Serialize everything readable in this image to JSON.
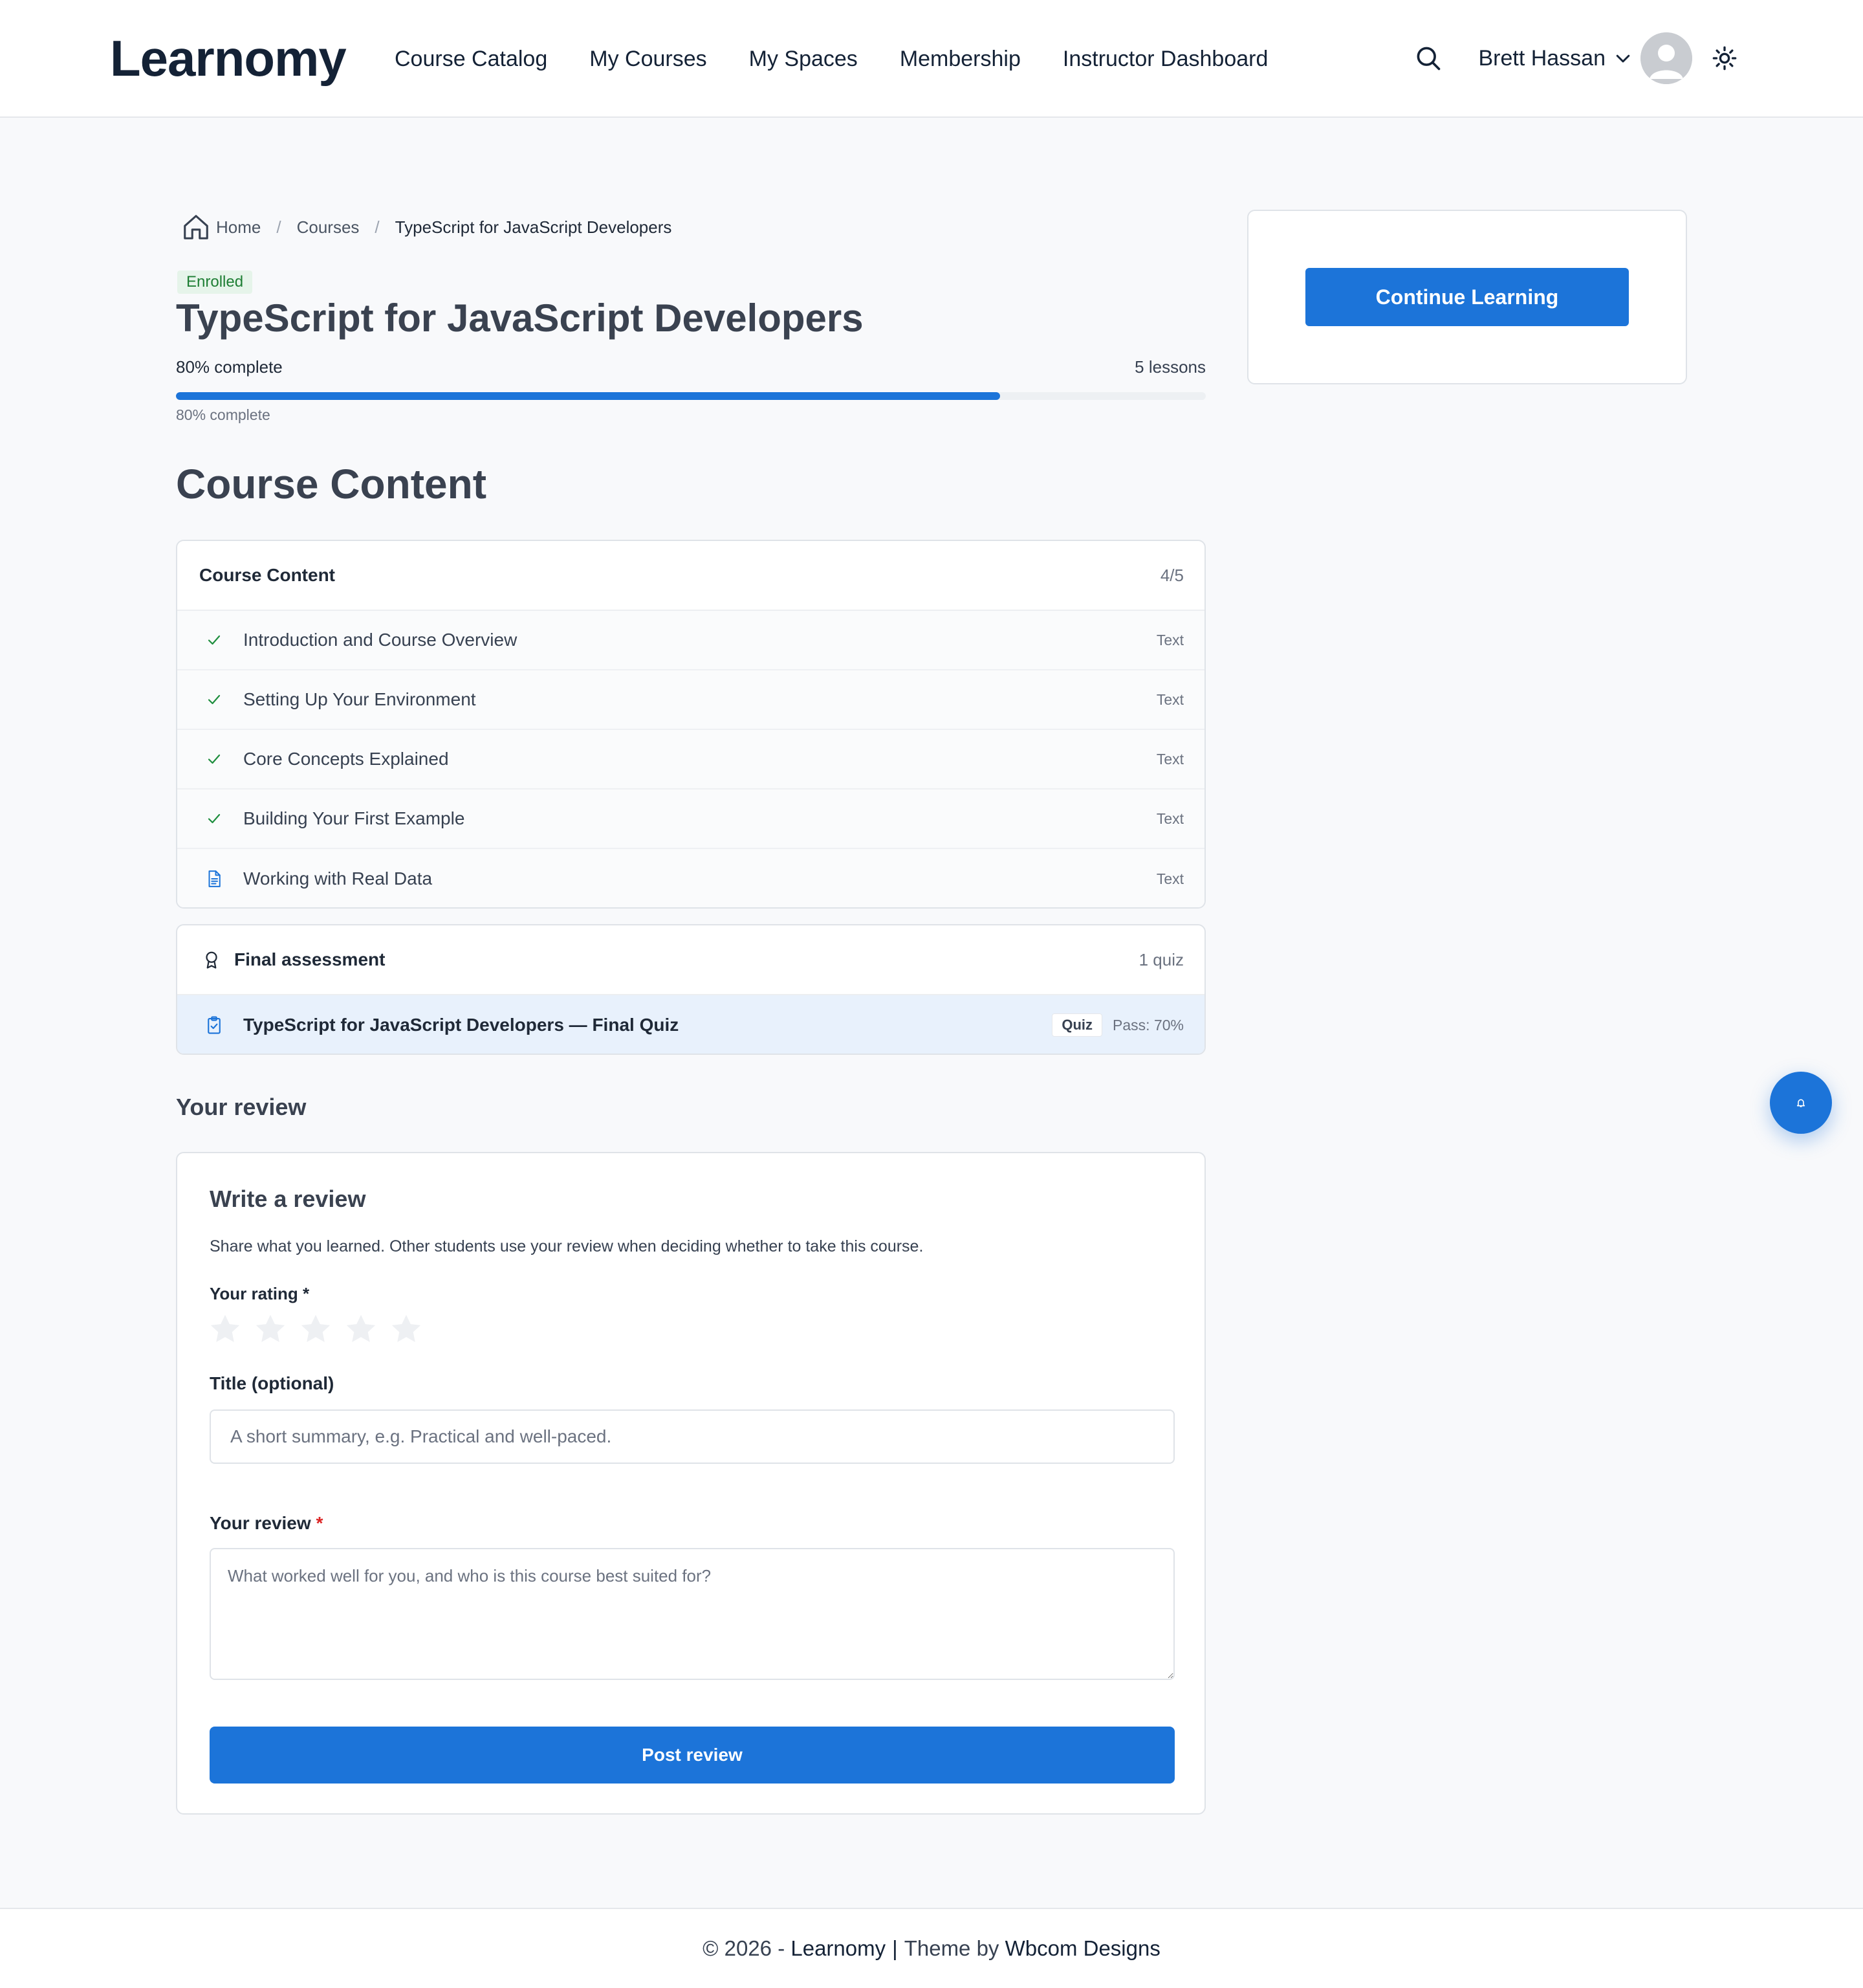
{
  "header": {
    "logo": "Learnomy",
    "nav": [
      "Course Catalog",
      "My Courses",
      "My Spaces",
      "Membership",
      "Instructor Dashboard"
    ],
    "user_name": "Brett Hassan",
    "icons": [
      "search-icon",
      "chevron-down-icon",
      "avatar",
      "sun-icon"
    ]
  },
  "breadcrumb": {
    "home": "Home",
    "separator": "/",
    "courses": "Courses",
    "current": "TypeScript for JavaScript Developers"
  },
  "course": {
    "status_badge": "Enrolled",
    "title": "TypeScript for JavaScript Developers",
    "progress_label": "80% complete",
    "lessons_count": "5 lessons",
    "progress_percent": 80,
    "progress_sub": "80% complete"
  },
  "content": {
    "section_title": "Course Content",
    "card_title": "Course Content",
    "card_count": "4/5",
    "lessons": [
      {
        "title": "Introduction and Course Overview",
        "type": "Text",
        "completed": true
      },
      {
        "title": "Setting Up Your Environment",
        "type": "Text",
        "completed": true
      },
      {
        "title": "Core Concepts Explained",
        "type": "Text",
        "completed": true
      },
      {
        "title": "Building Your First Example",
        "type": "Text",
        "completed": true
      },
      {
        "title": "Working with Real Data",
        "type": "Text",
        "completed": false
      }
    ]
  },
  "assessment": {
    "title": "Final assessment",
    "meta": "1 quiz",
    "quiz_title": "TypeScript for JavaScript Developers — Final Quiz",
    "quiz_badge": "Quiz",
    "quiz_pass": "Pass: 70%"
  },
  "review": {
    "heading": "Your review",
    "card_title": "Write a review",
    "description": "Share what you learned. Other students use your review when deciding whether to take this course.",
    "rating_label": "Your rating *",
    "rating_value": 0,
    "rating_max": 5,
    "title_label": "Title (optional)",
    "title_placeholder": "A short summary, e.g. Practical and well-paced.",
    "review_label": "Your review",
    "review_required_mark": "*",
    "review_placeholder": "What worked well for you, and who is this course best suited for?",
    "submit_label": "Post review"
  },
  "sidebar": {
    "continue_label": "Continue Learning"
  },
  "footer": {
    "prefix": "© 2026 - ",
    "site_name": "Learnomy",
    "separator": "|",
    "theme_prefix": "Theme by ",
    "theme_author": "Wbcom Designs"
  },
  "colors": {
    "accent": "#1c74d9",
    "success": "#1e7e34",
    "text_dark": "#142236",
    "quiz_row_bg": "#e8f1fc"
  }
}
